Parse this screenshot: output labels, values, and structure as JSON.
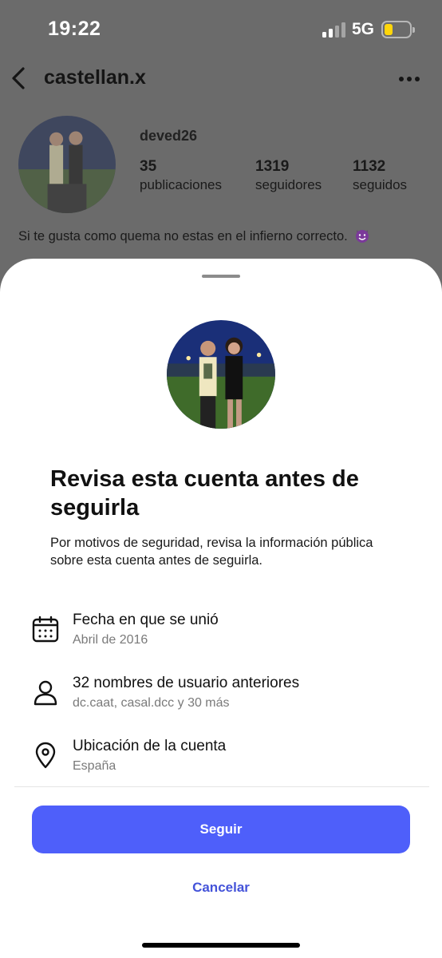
{
  "status_bar": {
    "time": "19:22",
    "network": "5G",
    "battery_color": "#ffd60a"
  },
  "profile": {
    "username": "castellan.x",
    "display_name": "deved26",
    "stats": [
      {
        "number": "35",
        "label": "publicaciones"
      },
      {
        "number": "1319",
        "label": "seguidores"
      },
      {
        "number": "1132",
        "label": "seguidos"
      }
    ],
    "bio": "Si te gusta como quema no estas en el infierno correcto.",
    "bio_emoji": "smiling-devil-emoji"
  },
  "sheet": {
    "title": "Revisa esta cuenta antes de seguirla",
    "description": "Por motivos de seguridad, revisa la información pública sobre esta cuenta antes de seguirla.",
    "items": [
      {
        "icon": "calendar-icon",
        "title": "Fecha en que se unió",
        "subtitle": "Abril de 2016"
      },
      {
        "icon": "person-icon",
        "title": "32 nombres de usuario anteriores",
        "subtitle": "dc.caat, casal.dcc y 30 más"
      },
      {
        "icon": "location-pin-icon",
        "title": "Ubicación de la cuenta",
        "subtitle": "España"
      }
    ],
    "follow_label": "Seguir",
    "cancel_label": "Cancelar",
    "accent_color": "#4e5ffa"
  }
}
